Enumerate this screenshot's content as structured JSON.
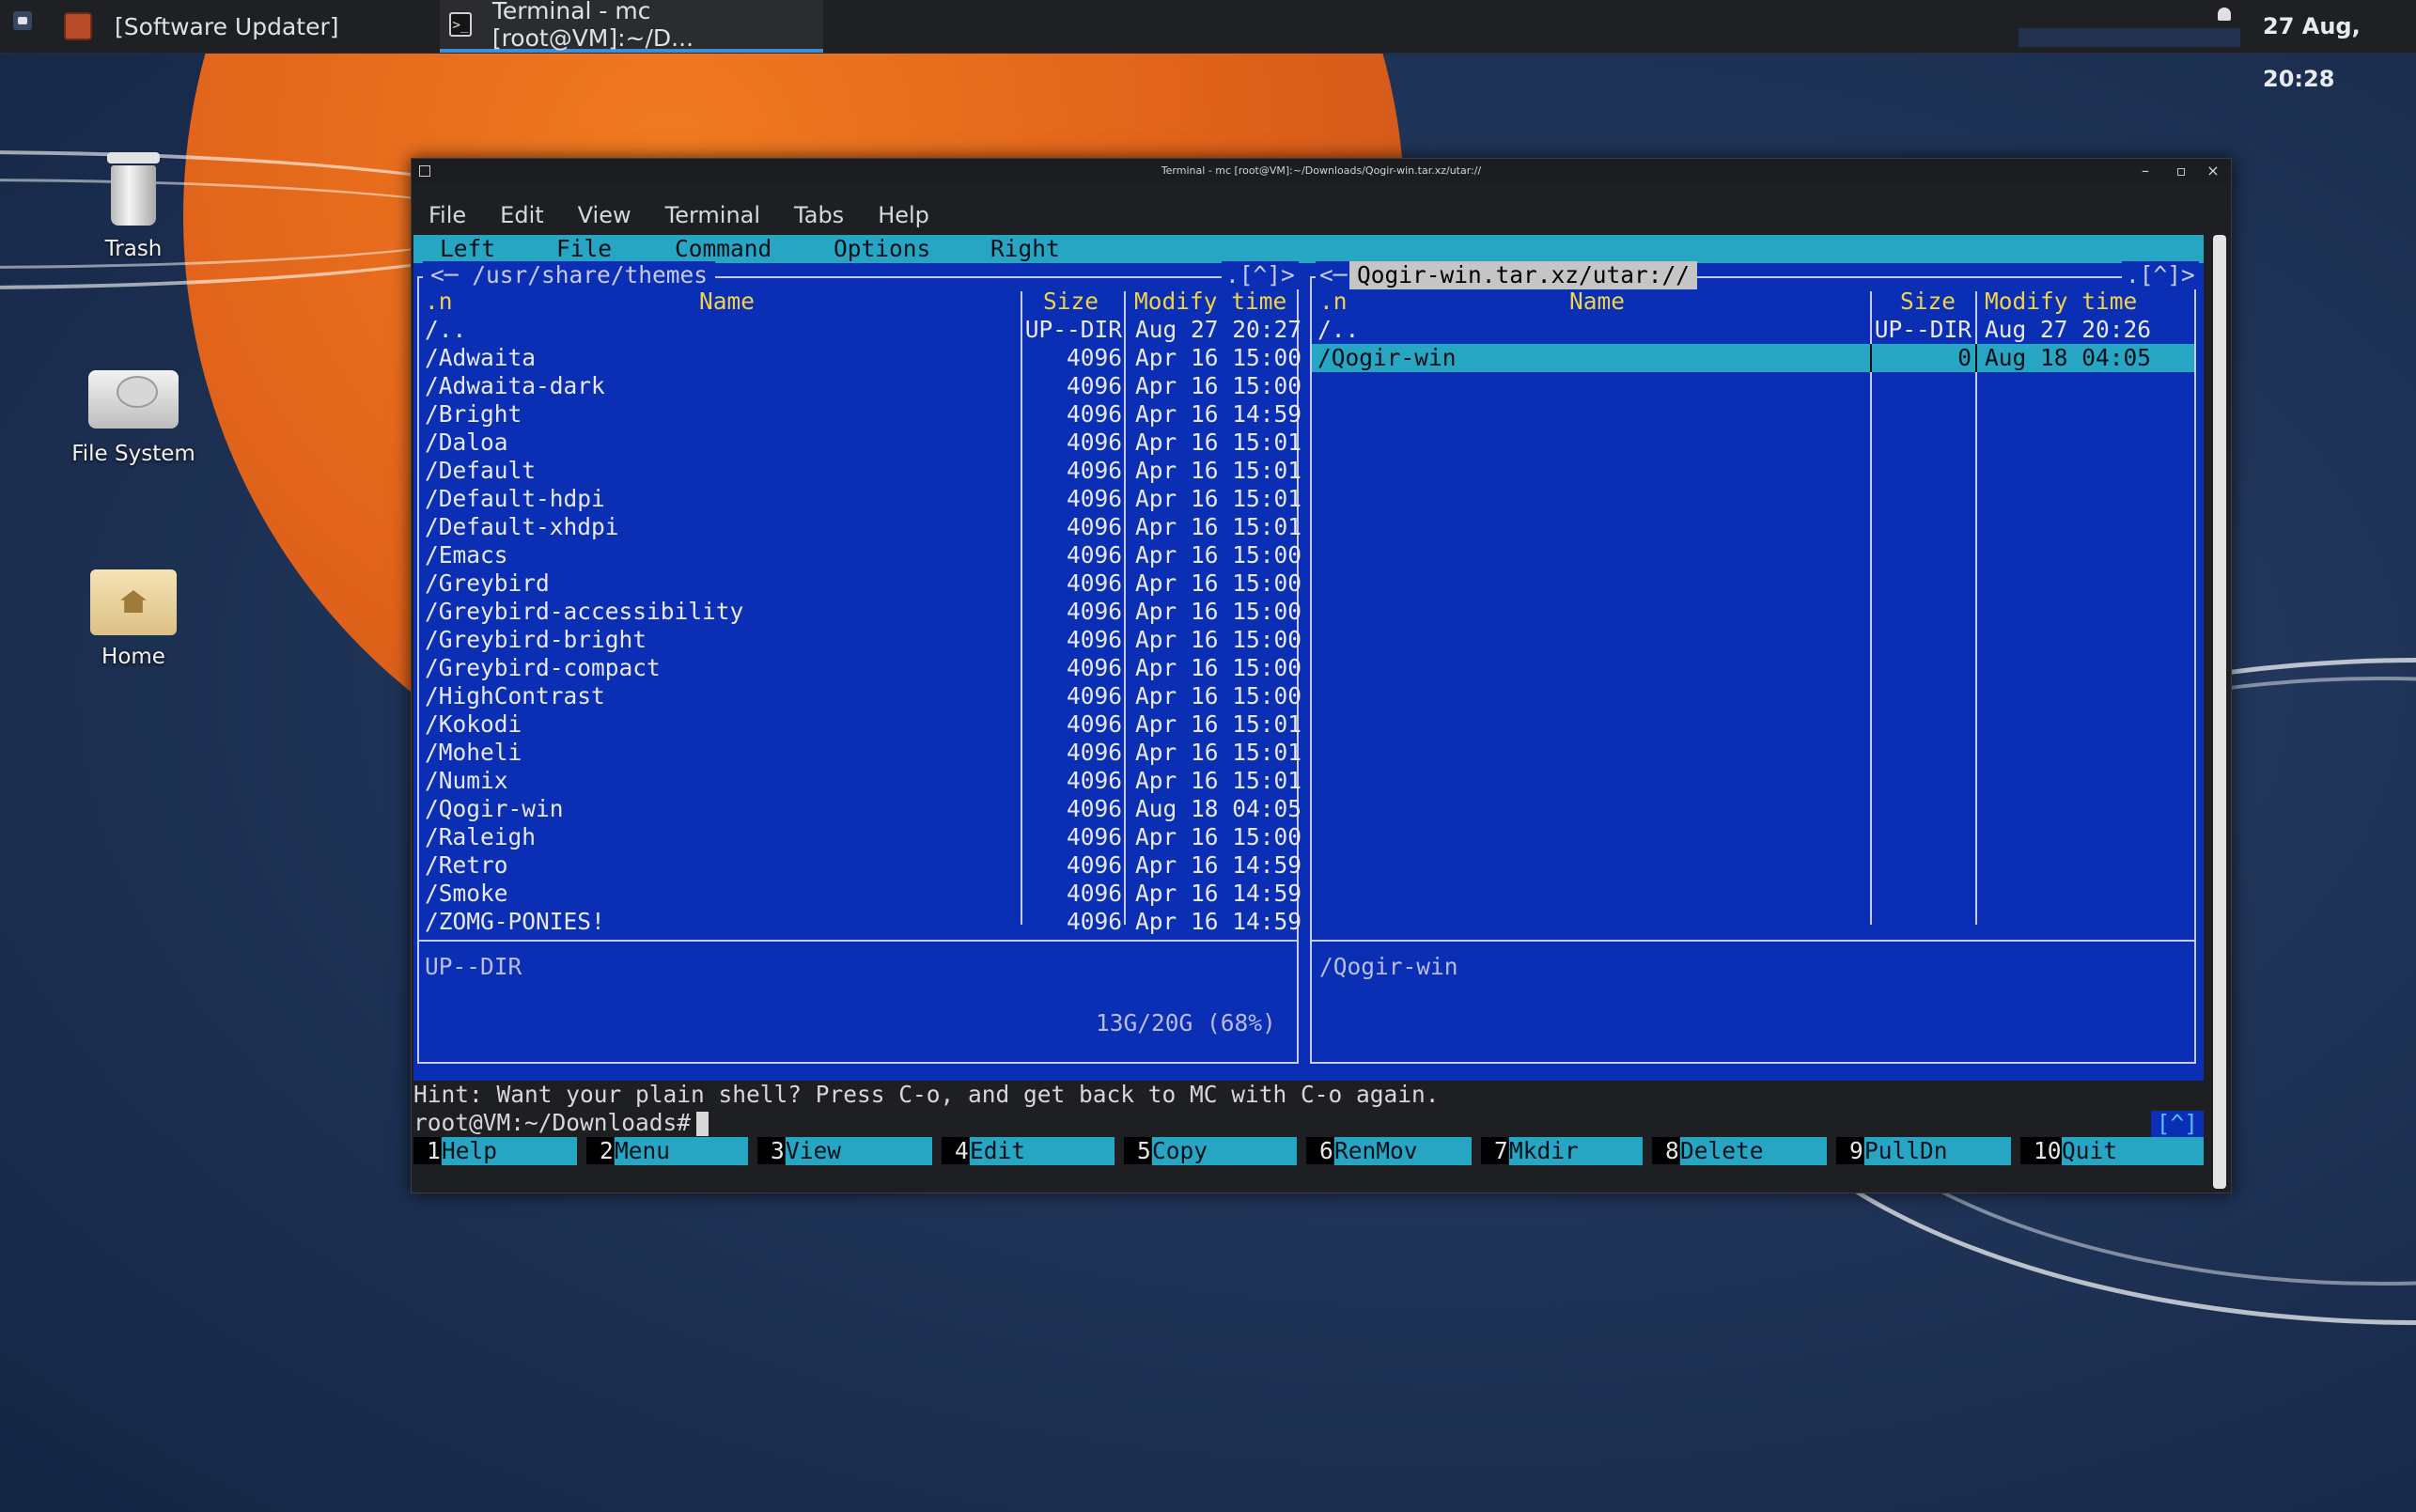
{
  "taskbar": {
    "tasks": [
      {
        "label": "[Software Updater]"
      },
      {
        "label": "Terminal - mc [root@VM]:~/D..."
      }
    ],
    "clock": "27 Aug, 20:28"
  },
  "desktop_icons": [
    {
      "label": "Trash",
      "icon": "trash-icon"
    },
    {
      "label": "File System",
      "icon": "drive-icon"
    },
    {
      "label": "Home",
      "icon": "home-folder-icon"
    }
  ],
  "window": {
    "title": "Terminal - mc [root@VM]:~/Downloads/Qogir-win.tar.xz/utar://",
    "menu": [
      "File",
      "Edit",
      "View",
      "Terminal",
      "Tabs",
      "Help"
    ]
  },
  "mc": {
    "menubar": [
      "Left",
      "File",
      "Command",
      "Options",
      "Right"
    ],
    "left_panel": {
      "path": "<─ /usr/share/themes",
      "corner": ".[^]>",
      "headers": {
        "n": ".n",
        "name": "Name",
        "size": "Size",
        "time": "Modify time"
      },
      "rows": [
        {
          "name": "/..",
          "size": "UP--DIR",
          "time": "Aug 27 20:27"
        },
        {
          "name": "/Adwaita",
          "size": "4096",
          "time": "Apr 16 15:00"
        },
        {
          "name": "/Adwaita-dark",
          "size": "4096",
          "time": "Apr 16 15:00"
        },
        {
          "name": "/Bright",
          "size": "4096",
          "time": "Apr 16 14:59"
        },
        {
          "name": "/Daloa",
          "size": "4096",
          "time": "Apr 16 15:01"
        },
        {
          "name": "/Default",
          "size": "4096",
          "time": "Apr 16 15:01"
        },
        {
          "name": "/Default-hdpi",
          "size": "4096",
          "time": "Apr 16 15:01"
        },
        {
          "name": "/Default-xhdpi",
          "size": "4096",
          "time": "Apr 16 15:01"
        },
        {
          "name": "/Emacs",
          "size": "4096",
          "time": "Apr 16 15:00"
        },
        {
          "name": "/Greybird",
          "size": "4096",
          "time": "Apr 16 15:00"
        },
        {
          "name": "/Greybird-accessibility",
          "size": "4096",
          "time": "Apr 16 15:00"
        },
        {
          "name": "/Greybird-bright",
          "size": "4096",
          "time": "Apr 16 15:00"
        },
        {
          "name": "/Greybird-compact",
          "size": "4096",
          "time": "Apr 16 15:00"
        },
        {
          "name": "/HighContrast",
          "size": "4096",
          "time": "Apr 16 15:00"
        },
        {
          "name": "/Kokodi",
          "size": "4096",
          "time": "Apr 16 15:01"
        },
        {
          "name": "/Moheli",
          "size": "4096",
          "time": "Apr 16 15:01"
        },
        {
          "name": "/Numix",
          "size": "4096",
          "time": "Apr 16 15:01"
        },
        {
          "name": "/Qogir-win",
          "size": "4096",
          "time": "Aug 18 04:05"
        },
        {
          "name": "/Raleigh",
          "size": "4096",
          "time": "Apr 16 15:00"
        },
        {
          "name": "/Retro",
          "size": "4096",
          "time": "Apr 16 14:59"
        },
        {
          "name": "/Smoke",
          "size": "4096",
          "time": "Apr 16 14:59"
        },
        {
          "name": "/ZOMG-PONIES!",
          "size": "4096",
          "time": "Apr 16 14:59"
        }
      ],
      "status": "UP--DIR",
      "disk_usage": "13G/20G (68%)"
    },
    "right_panel": {
      "left_corner": "<─",
      "path": "Qogir-win.tar.xz/utar://",
      "corner": ".[^]>",
      "headers": {
        "n": ".n",
        "name": "Name",
        "size": "Size",
        "time": "Modify time"
      },
      "rows": [
        {
          "name": "/..",
          "size": "UP--DIR",
          "time": "Aug 27 20:26"
        },
        {
          "name": "/Qogir-win",
          "size": "0",
          "time": "Aug 18 04:05",
          "selected": true
        }
      ],
      "status": "/Qogir-win"
    },
    "hint": "Hint: Want your plain shell? Press C-o, and get back to MC with C-o again.",
    "prompt": "root@VM:~/Downloads#",
    "scroll_indicator": "[^]",
    "fkeys": [
      {
        "num": "1",
        "label": "Help"
      },
      {
        "num": "2",
        "label": "Menu"
      },
      {
        "num": "3",
        "label": "View"
      },
      {
        "num": "4",
        "label": "Edit"
      },
      {
        "num": "5",
        "label": "Copy"
      },
      {
        "num": "6",
        "label": "RenMov"
      },
      {
        "num": "7",
        "label": "Mkdir"
      },
      {
        "num": "8",
        "label": "Delete"
      },
      {
        "num": "9",
        "label": "PullDn"
      },
      {
        "num": "10",
        "label": "Quit"
      }
    ]
  },
  "colors": {
    "panel_bg": "#0a2fb4",
    "menu_bg": "#27a6c4",
    "header_fg": "#f1d34a"
  }
}
